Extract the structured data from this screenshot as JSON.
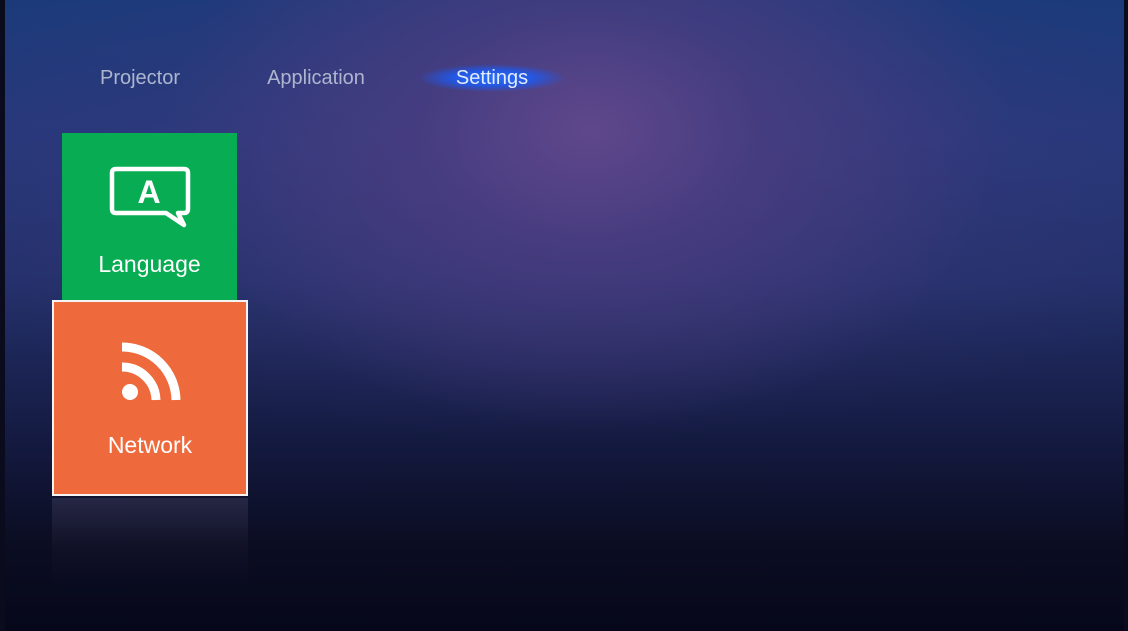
{
  "nav": {
    "tabs": [
      {
        "label": "Projector",
        "active": false
      },
      {
        "label": "Application",
        "active": false
      },
      {
        "label": "Settings",
        "active": true
      }
    ]
  },
  "tiles": [
    {
      "label": "Language",
      "icon": "language-icon",
      "color": "#08ac52",
      "icon_glyph": "A"
    },
    {
      "label": "Network",
      "icon": "wifi-signal-icon",
      "color": "#ee6a3c",
      "focused": true
    }
  ],
  "colors": {
    "tab_active_glow": "#2e6cff",
    "tab_text": "#aeb6cf",
    "focus_border": "#f4f4f4"
  }
}
